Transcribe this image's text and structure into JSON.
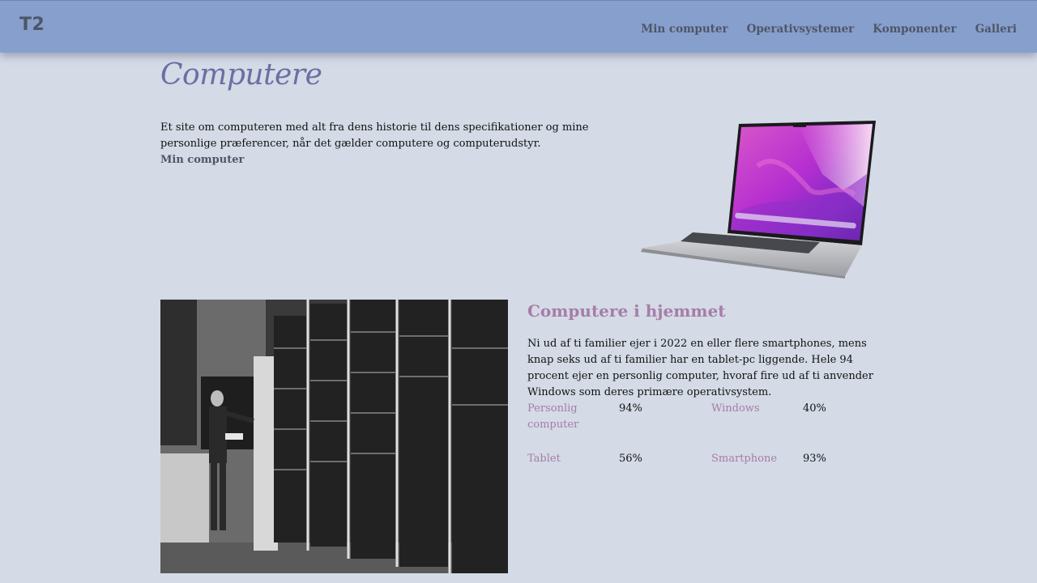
{
  "header": {
    "logo": "T2",
    "nav": [
      "Min computer",
      "Operativsystemer",
      "Komponenter",
      "Galleri"
    ]
  },
  "hero": {
    "title": "Computere",
    "text": "Et site om computeren med alt fra dens historie til dens specifikationer og mine personlige præferencer, når det gælder computere og computerudstyr.",
    "link": "Min computer"
  },
  "section": {
    "title": "Computere i hjemmet",
    "text": "Ni ud af ti familier ejer i 2022 en eller flere smartphones, mens knap seks ud af ti familier har en tablet-pc liggende. Hele 94 procent ejer en personlig computer, hvoraf fire ud af ti anvender Windows som deres primære operativsystem.",
    "stats": [
      {
        "label": "Personlig computer",
        "value": "94%"
      },
      {
        "label": "Windows",
        "value": "40%"
      },
      {
        "label": "Tablet",
        "value": "56%"
      },
      {
        "label": "Smartphone",
        "value": "93%"
      }
    ]
  },
  "colors": {
    "header": "#879fcd",
    "background": "#d4dae6",
    "accent": "#a57ea8",
    "title": "#6a6fa3"
  }
}
